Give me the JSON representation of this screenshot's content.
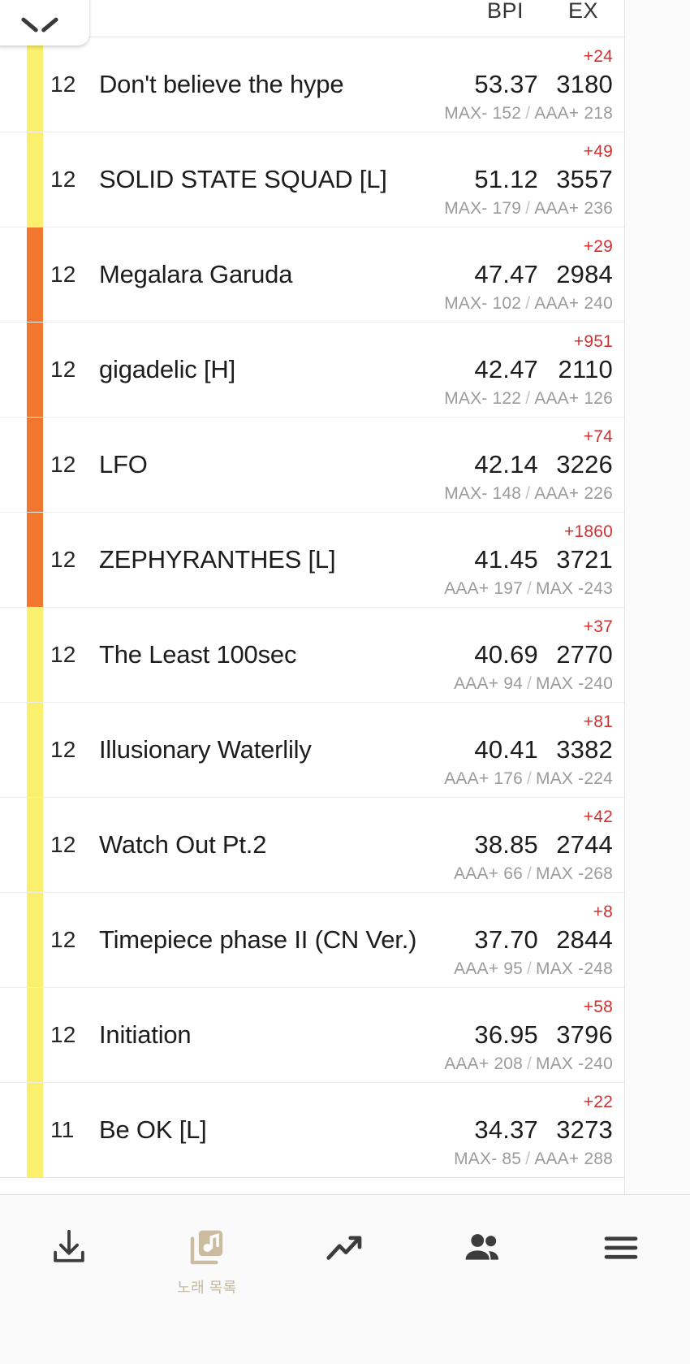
{
  "header": {
    "collapse_icon": "chevron-down-icon",
    "columns": [
      {
        "key": "bpi",
        "label": "BPI"
      },
      {
        "key": "ex",
        "label": "EX"
      }
    ]
  },
  "colors": {
    "lamp_yellow": "#faf06e",
    "lamp_orange": "#f2762e",
    "delta_red": "#d32f2f",
    "sub_gray": "#9b9b9b",
    "nav_label": "#c8b89c"
  },
  "rows": [
    {
      "level": "12",
      "title": "Don't believe the hype",
      "delta": "+24",
      "bpi": "53.37",
      "ex": "3180",
      "sub_left": "MAX- 152",
      "sub_right": "AAA+ 218",
      "lamp": "yellow"
    },
    {
      "level": "12",
      "title": "SOLID STATE SQUAD [L]",
      "delta": "+49",
      "bpi": "51.12",
      "ex": "3557",
      "sub_left": "MAX- 179",
      "sub_right": "AAA+ 236",
      "lamp": "yellow"
    },
    {
      "level": "12",
      "title": "Megalara Garuda",
      "delta": "+29",
      "bpi": "47.47",
      "ex": "2984",
      "sub_left": "MAX- 102",
      "sub_right": "AAA+ 240",
      "lamp": "orange"
    },
    {
      "level": "12",
      "title": "gigadelic [H]",
      "delta": "+951",
      "bpi": "42.47",
      "ex": "2110",
      "sub_left": "MAX- 122",
      "sub_right": "AAA+ 126",
      "lamp": "orange"
    },
    {
      "level": "12",
      "title": "LFO",
      "delta": "+74",
      "bpi": "42.14",
      "ex": "3226",
      "sub_left": "MAX- 148",
      "sub_right": "AAA+ 226",
      "lamp": "orange"
    },
    {
      "level": "12",
      "title": "ZEPHYRANTHES [L]",
      "delta": "+1860",
      "bpi": "41.45",
      "ex": "3721",
      "sub_left": "AAA+ 197",
      "sub_right": "MAX -243",
      "lamp": "orange"
    },
    {
      "level": "12",
      "title": "The Least 100sec",
      "delta": "+37",
      "bpi": "40.69",
      "ex": "2770",
      "sub_left": "AAA+ 94",
      "sub_right": "MAX -240",
      "lamp": "yellow"
    },
    {
      "level": "12",
      "title": "Illusionary Waterlily",
      "delta": "+81",
      "bpi": "40.41",
      "ex": "3382",
      "sub_left": "AAA+ 176",
      "sub_right": "MAX -224",
      "lamp": "yellow"
    },
    {
      "level": "12",
      "title": "Watch Out Pt.2",
      "delta": "+42",
      "bpi": "38.85",
      "ex": "2744",
      "sub_left": "AAA+ 66",
      "sub_right": "MAX -268",
      "lamp": "yellow"
    },
    {
      "level": "12",
      "title": "Timepiece phase II (CN Ver.)",
      "delta": "+8",
      "bpi": "37.70",
      "ex": "2844",
      "sub_left": "AAA+ 95",
      "sub_right": "MAX -248",
      "lamp": "yellow"
    },
    {
      "level": "12",
      "title": "Initiation",
      "delta": "+58",
      "bpi": "36.95",
      "ex": "3796",
      "sub_left": "AAA+ 208",
      "sub_right": "MAX -240",
      "lamp": "yellow"
    },
    {
      "level": "11",
      "title": "Be OK [L]",
      "delta": "+22",
      "bpi": "34.37",
      "ex": "3273",
      "sub_left": "MAX- 85",
      "sub_right": "AAA+ 288",
      "lamp": "yellow"
    }
  ],
  "bottom_nav": [
    {
      "icon": "download-icon",
      "label": ""
    },
    {
      "icon": "music-list-icon",
      "label": "노래 목록"
    },
    {
      "icon": "trending-up-icon",
      "label": ""
    },
    {
      "icon": "people-icon",
      "label": ""
    },
    {
      "icon": "hamburger-menu-icon",
      "label": ""
    }
  ]
}
